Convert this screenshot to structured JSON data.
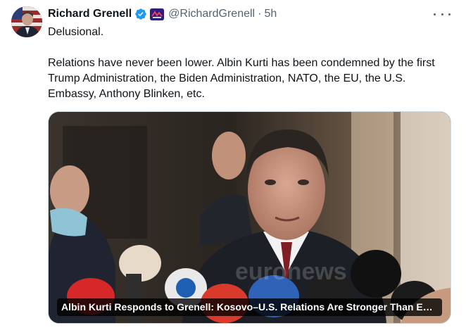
{
  "tweet": {
    "author_name": "Richard Grenell",
    "handle": "@RichardGrenell",
    "separator": "·",
    "time": "5h",
    "text_lines": [
      "Delusional.",
      "Relations have never been lower. Albin Kurti has been condemned by the first Trump Administration, the Biden Administration, NATO, the EU, the U.S. Embassy, Anthony Blinken, etc."
    ],
    "media_caption": "Albin Kurti Responds to Grenell: Kosovo–U.S. Relations Are Stronger Than Ever…"
  },
  "icons": {
    "verified": "verified-badge-icon",
    "affiliation": "affiliation-badge-icon",
    "more": "more-options-icon"
  },
  "colors": {
    "verified_blue": "#1d9bf0",
    "secondary_text": "#536471",
    "border": "#cfd9de"
  }
}
